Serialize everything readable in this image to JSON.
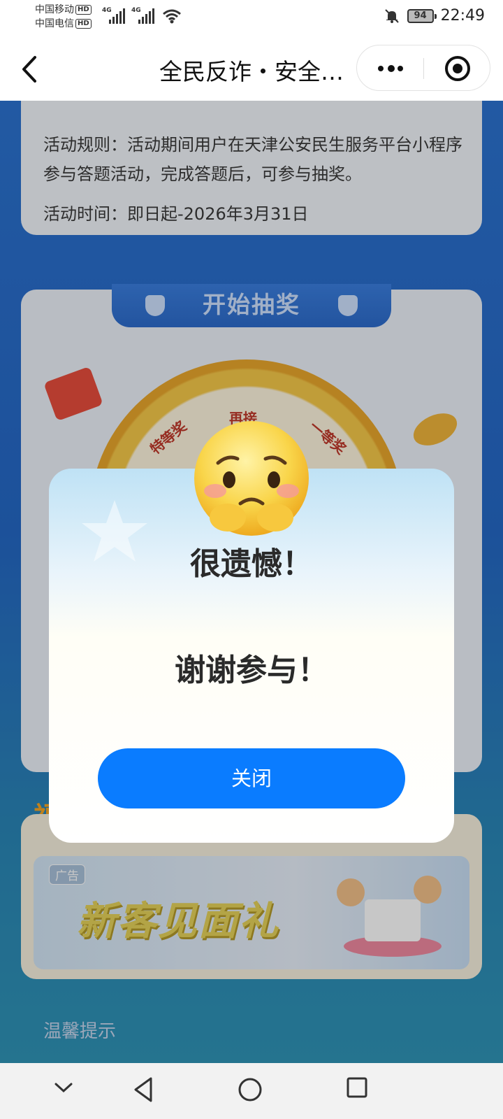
{
  "status_bar": {
    "carrier1": "中国移动",
    "carrier2": "中国电信",
    "hd": "HD",
    "network": "4G",
    "battery": "94",
    "time": "22:49"
  },
  "navbar": {
    "title": "全民反诈・安全…"
  },
  "rules_card": {
    "rules": "活动规则：活动期间用户在天津公安民生服务平台小程序参与答题活动，完成答题后，可参与抽奖。",
    "time": "活动时间：即日起-2026年3月31日"
  },
  "lottery": {
    "tab_label": "开始抽奖",
    "wheel_labels": [
      "特等奖",
      "再接",
      "一等奖"
    ]
  },
  "ad": {
    "tag": "广告",
    "title": "新客见面礼",
    "section_prefix": "福"
  },
  "tips": {
    "title": "温馨提示"
  },
  "modal": {
    "title": "很遗憾！",
    "message": "谢谢参与！",
    "close_label": "关闭"
  },
  "colors": {
    "accent": "#0a7cff",
    "page_bg": "#2568c6",
    "modal_text": "#2a2a2a"
  }
}
